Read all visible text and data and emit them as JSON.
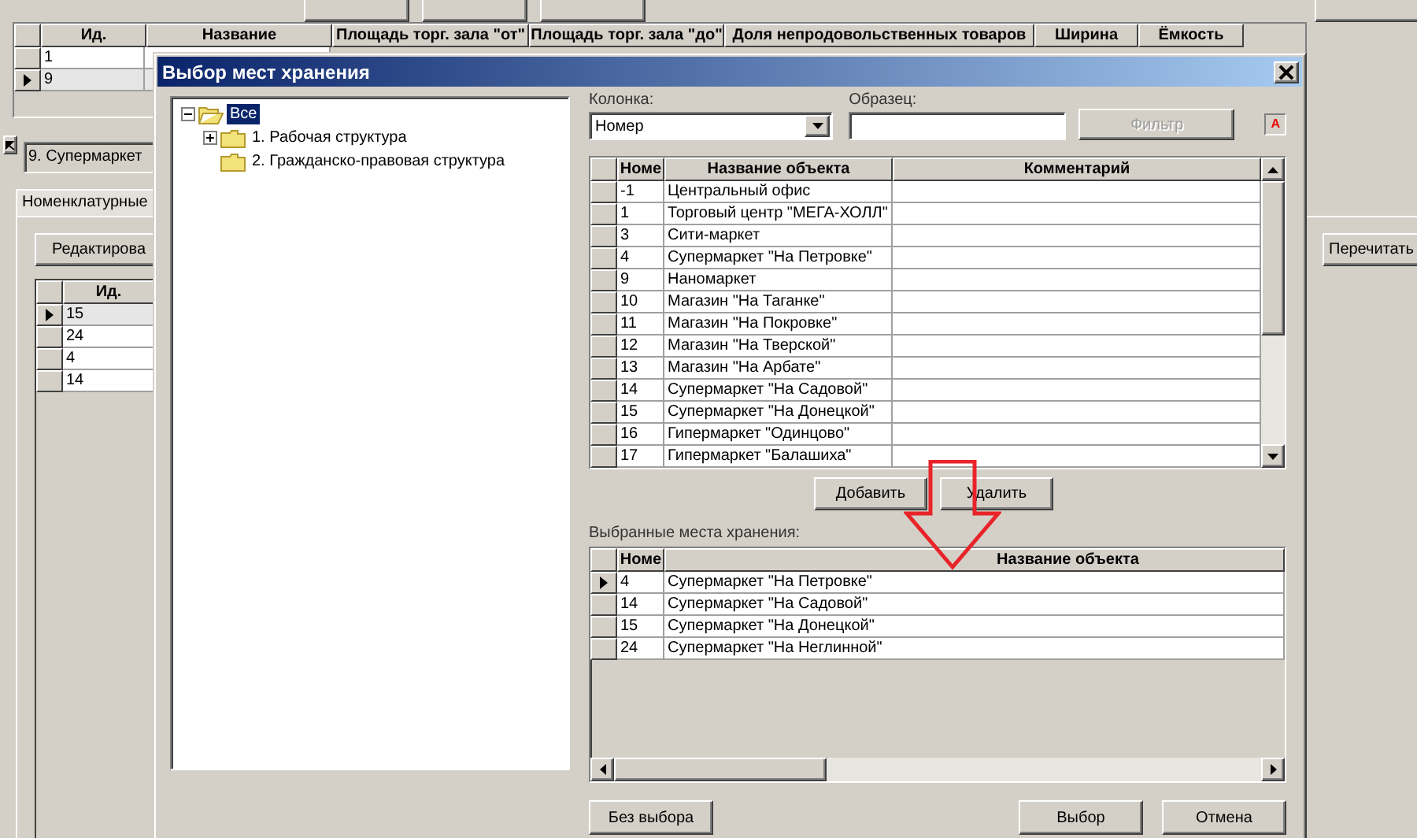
{
  "background": {
    "matrix_table": {
      "columns": [
        "Ид.",
        "Название",
        "Площадь торг. зала \"от\"",
        "Площадь торг. зала \"до\"",
        "Доля непродовольственных товаров",
        "Ширина",
        "Ёмкость"
      ],
      "rows": [
        {
          "id": "1",
          "selected": false
        },
        {
          "id": "9",
          "selected": true
        }
      ]
    },
    "store_field": {
      "value": "9. Супермаркет"
    },
    "tabs": [
      {
        "label": "Номенклатурные",
        "selected": true
      }
    ],
    "edit_button": "Редактирова",
    "reload_button": "Перечитать",
    "items_table": {
      "columns": [
        "Ид."
      ],
      "rows": [
        {
          "id": "15",
          "selected": true
        },
        {
          "id": "24",
          "selected": false
        },
        {
          "id": "4",
          "selected": false
        },
        {
          "id": "14",
          "selected": false
        }
      ]
    }
  },
  "dialog": {
    "title": "Выбор мест хранения",
    "tree": [
      {
        "label": "Все",
        "selected": true,
        "expandable": true,
        "expanded": true,
        "children": [
          {
            "label": "1. Рабочая структура",
            "selected": false,
            "expandable": true,
            "expanded": false
          },
          {
            "label": "2. Гражданско-правовая структура",
            "selected": false,
            "expandable": false,
            "expanded": false
          }
        ]
      }
    ],
    "column_label": "Колонка:",
    "column_value": "Номер",
    "sample_label": "Образец:",
    "filter_button": {
      "label": "Фильтр",
      "disabled": true
    },
    "filter_flag": "A",
    "objects_table": {
      "columns": [
        "Номе",
        "Название объекта",
        "Комментарий"
      ],
      "rows": [
        {
          "number": "-1",
          "name": "Центральный офис"
        },
        {
          "number": "1",
          "name": "Торговый центр \"МЕГА-ХОЛЛ\""
        },
        {
          "number": "3",
          "name": "Сити-маркет"
        },
        {
          "number": "4",
          "name": "Супермаркет \"На Петровке\""
        },
        {
          "number": "9",
          "name": "Наномаркет"
        },
        {
          "number": "10",
          "name": "Магазин \"На Таганке\""
        },
        {
          "number": "11",
          "name": "Магазин \"На Покровке\""
        },
        {
          "number": "12",
          "name": "Магазин \"На Тверской\""
        },
        {
          "number": "13",
          "name": "Магазин \"На Арбате\""
        },
        {
          "number": "14",
          "name": "Супермаркет \"На Садовой\""
        },
        {
          "number": "15",
          "name": "Супермаркет \"На Донецкой\""
        },
        {
          "number": "16",
          "name": "Гипермаркет \"Одинцово\""
        },
        {
          "number": "17",
          "name": "Гипермаркет \"Балашиха\""
        }
      ]
    },
    "add_button": "Добавить",
    "remove_button": "Удалить",
    "selected_label": "Выбранные места хранения:",
    "selected_table": {
      "columns": [
        "Номе",
        "Название объекта"
      ],
      "rows": [
        {
          "number": "4",
          "name": "Супермаркет \"На Петровке\"",
          "selected": true
        },
        {
          "number": "14",
          "name": "Супермаркет \"На Садовой\"",
          "selected": false
        },
        {
          "number": "15",
          "name": "Супермаркет \"На Донецкой\"",
          "selected": false
        },
        {
          "number": "24",
          "name": "Супермаркет \"На Неглинной\"",
          "selected": false
        }
      ]
    },
    "buttons": [
      "Без выбора",
      "Выбор",
      "Отмена"
    ]
  }
}
